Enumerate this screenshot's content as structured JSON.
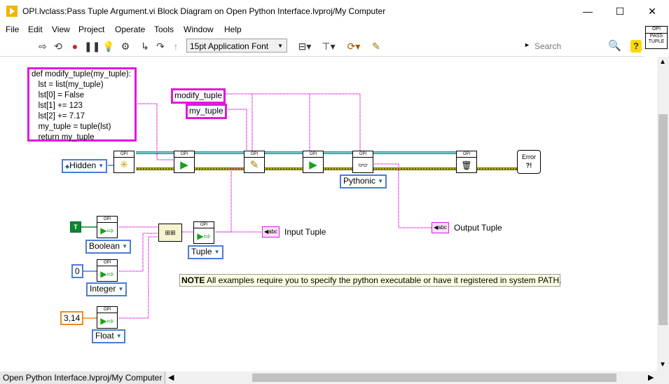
{
  "window": {
    "title": "OPI.lvclass:Pass Tuple Argument.vi Block Diagram on Open Python Interface.lvproj/My Computer",
    "minimize": "—",
    "maximize": "☐",
    "close": "✕"
  },
  "menu": [
    "File",
    "Edit",
    "View",
    "Project",
    "Operate",
    "Tools",
    "Window",
    "Help"
  ],
  "toolbar": {
    "font": "15pt Application Font",
    "search_placeholder": "Search",
    "help": "?"
  },
  "vi_icon": {
    "top": "OPI",
    "line1": "PASS",
    "line2": "TUPLE"
  },
  "diagram": {
    "code_lines": [
      "def modify_tuple(my_tuple):",
      "   lst = list(my_tuple)",
      "   lst[0] = False",
      "   lst[1] += 123",
      "   lst[2] += 7.17",
      "   my_tuple = tuple(lst)",
      "   return my_tuple"
    ],
    "const_function": "modify_tuple",
    "const_arg": "my_tuple",
    "ring_hidden": "Hidden",
    "ring_pythonic": "Pythonic",
    "ring_boolean": "Boolean",
    "ring_integer": "Integer",
    "ring_float": "Float",
    "ring_tuple": "Tuple",
    "node_header": "OPI",
    "bool_value": "T",
    "int_value": "0",
    "float_value": "3,14",
    "indicator_abc": "abc",
    "input_tuple_label": "Input Tuple",
    "output_tuple_label": "Output Tuple",
    "error_label": "Error",
    "note_bold": "NOTE",
    "note_text": " All examples require you to specify the python executable or have it registered in system PATH."
  },
  "status": {
    "path": "Open Python Interface.lvproj/My Computer"
  },
  "colors": {
    "string_wire": "#e018e0",
    "class_wire": "#2e8b8b",
    "error_wire": "#c8c800",
    "bool_const": "#0a8a24",
    "int_const": "#4a7cd8",
    "dbl_const": "#f08a20"
  }
}
